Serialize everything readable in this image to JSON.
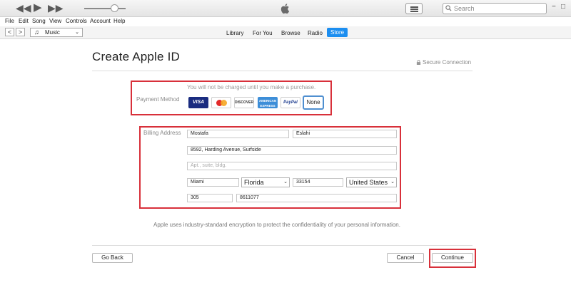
{
  "player": {
    "search_placeholder": "Search",
    "win_minimize": "−",
    "win_maximize": "□",
    "win_close": "✕",
    "icons": {
      "rewind": "rewind-icon",
      "play": "play-icon",
      "fast_forward": "fast-forward-icon",
      "apple": "apple-logo",
      "list": "list-icon",
      "search": "search-icon"
    },
    "volume_level": 0.72
  },
  "menu": [
    "File",
    "Edit",
    "Song",
    "View",
    "Controls",
    "Account",
    "Help"
  ],
  "nav": {
    "back_glyph": "<",
    "forward_glyph": ">",
    "media_kind": "Music",
    "tabs": [
      "Library",
      "For You",
      "Browse",
      "Radio",
      "Store"
    ],
    "active_tab": "Store",
    "active_color": "#1c8ef0"
  },
  "page": {
    "title": "Create Apple ID",
    "secure_connection": "Secure Connection"
  },
  "payment": {
    "notice": "You will not be charged until you make a purchase.",
    "label": "Payment Method",
    "cards": [
      {
        "name": "visa",
        "label": "VISA"
      },
      {
        "name": "mastercard",
        "label": ""
      },
      {
        "name": "discover",
        "label": "DISCOVER"
      },
      {
        "name": "amex",
        "label": "AMERICAN EXPRESS"
      },
      {
        "name": "paypal",
        "label": "PayPal"
      }
    ],
    "selected": "None"
  },
  "billing": {
    "label": "Billing Address",
    "first_name": "Mostafa",
    "last_name": "Eslahi",
    "street": "8592, Harding Avenue, Surfside",
    "apt_placeholder": "Apt., suite, bldg.",
    "city": "Miami",
    "state": "Florida",
    "zip": "33154",
    "country": "United States",
    "area_code": "305",
    "phone": "8611077"
  },
  "footer": {
    "encryption_note": "Apple uses industry-standard encryption to protect the confidentiality of your personal information.",
    "go_back": "Go Back",
    "cancel": "Cancel",
    "continue": "Continue"
  },
  "highlight_color": "#d8303a"
}
